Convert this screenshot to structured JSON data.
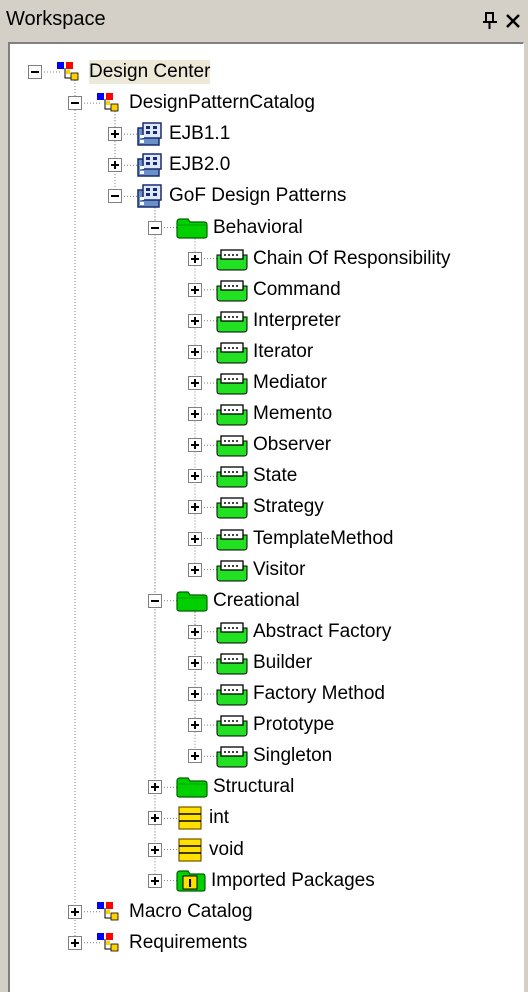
{
  "window": {
    "title": "Workspace",
    "pin_icon": "pin-icon",
    "close_icon": "close-icon"
  },
  "tree": {
    "root": "Design Center",
    "catalog": "DesignPatternCatalog",
    "ejb11": "EJB1.1",
    "ejb20": "EJB2.0",
    "gof": "GoF Design Patterns",
    "behavioral": {
      "label": "Behavioral",
      "items": [
        "Chain Of Responsibility",
        "Command",
        "Interpreter",
        "Iterator",
        "Mediator",
        "Memento",
        "Observer",
        "State",
        "Strategy",
        "TemplateMethod",
        "Visitor"
      ]
    },
    "creational": {
      "label": "Creational",
      "items": [
        "Abstract Factory",
        "Builder",
        "Factory Method",
        "Prototype",
        "Singleton"
      ]
    },
    "structural": "Structural",
    "int": "int",
    "void": "void",
    "imported": "Imported Packages",
    "macro": "Macro Catalog",
    "requirements": "Requirements"
  },
  "colors": {
    "folder": "#00d000",
    "pattern": "#22e022",
    "selection": "#ece9d8"
  }
}
